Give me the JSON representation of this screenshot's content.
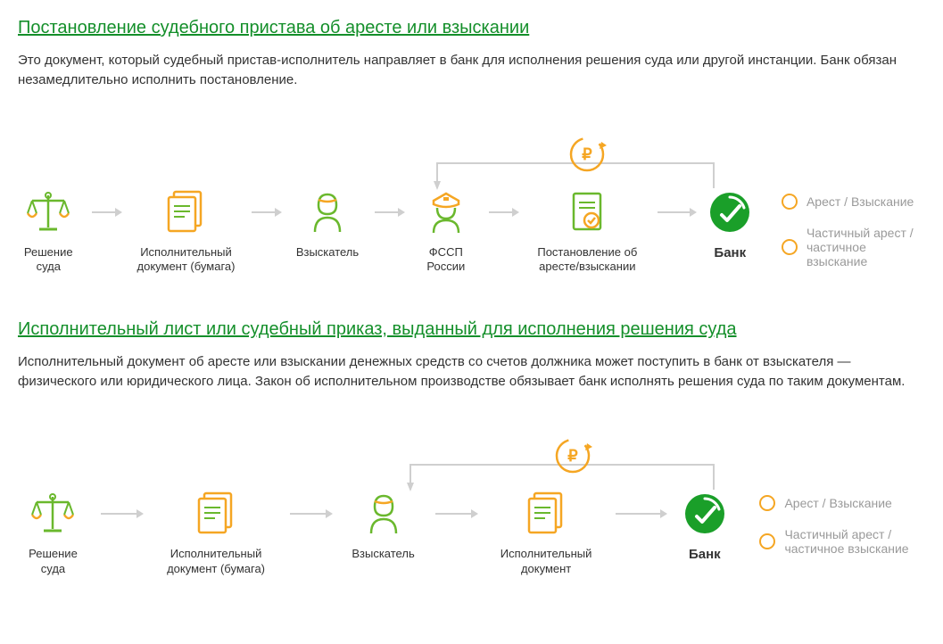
{
  "section1": {
    "title": "Постановление судебного пристава об аресте или взыскании",
    "desc": "Это документ, который судебный пристав-исполнитель направляет в банк для исполнения решения суда или другой инстанции. Банк обязан незамедлительно исполнить постановление.",
    "steps": {
      "s0": "Решение суда",
      "s1": "Исполнительный документ (бумага)",
      "s2": "Взыскатель",
      "s3": "ФССП России",
      "s4": "Постановление об аресте/взыскании",
      "s5": "Банк"
    },
    "outcomes": {
      "o1": "Арест / Взыскание",
      "o2": "Частичный арест / частичное взыскание"
    }
  },
  "section2": {
    "title": "Исполнительный лист или судебный приказ, выданный для исполнения решения суда",
    "desc": "Исполнительный документ об аресте или взыскании денежных средств со счетов должника может поступить в банк от взыскателя — физического или юридического лица. Закон об исполнительном производстве обязывает банк исполнять решения суда по таким документам.",
    "steps": {
      "s0": "Решение суда",
      "s1": "Исполнительный документ (бумага)",
      "s2": "Взыскатель",
      "s3": "Исполнительный документ",
      "s4": "Банк"
    },
    "outcomes": {
      "o1": "Арест / Взыскание",
      "o2": "Частичный арест / частичное взыскание"
    }
  },
  "icons": {
    "scales": "scales-icon",
    "doc": "document-icon",
    "person": "person-icon",
    "officer": "officer-icon",
    "checkdoc": "check-document-icon",
    "bank": "bank-icon",
    "ruble": "ruble-icon"
  }
}
